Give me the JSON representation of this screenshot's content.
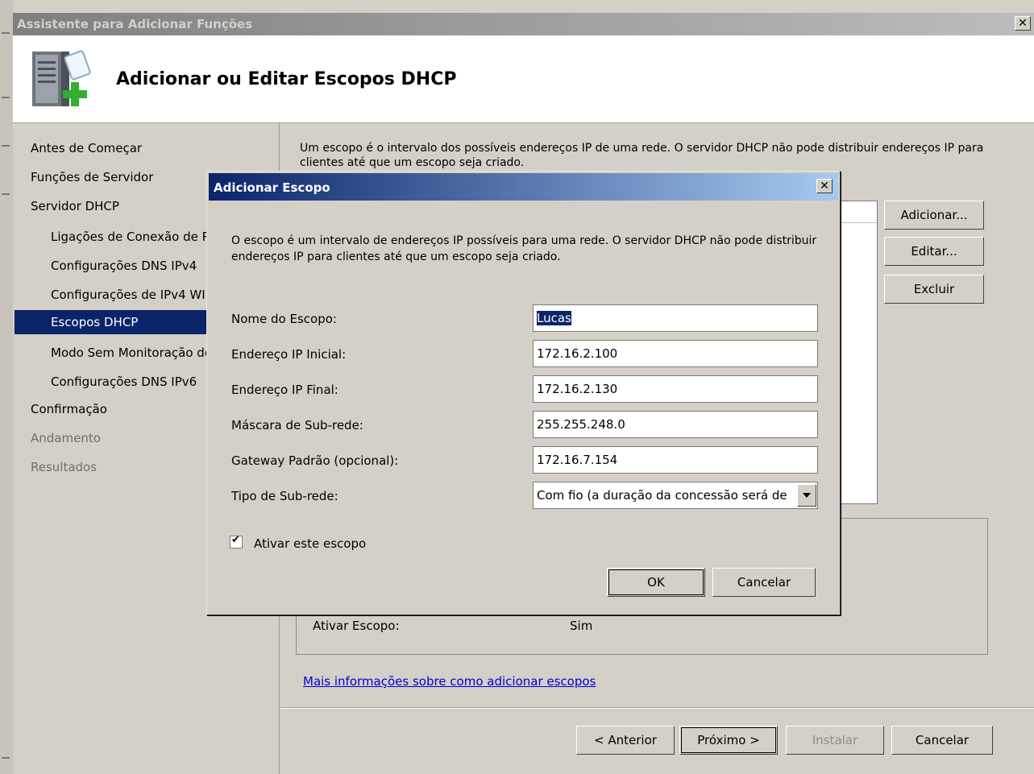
{
  "window": {
    "title": "Assistente para Adicionar Funções",
    "close_glyph": "✕"
  },
  "header": {
    "title": "Adicionar ou Editar Escopos DHCP",
    "icon": "server-add-icon"
  },
  "nav": {
    "items": [
      {
        "label": "Antes de Começar"
      },
      {
        "label": "Funções de Servidor"
      },
      {
        "label": "Servidor DHCP"
      },
      {
        "label": "Ligações de Conexão de Rede"
      },
      {
        "label": "Configurações DNS IPv4"
      },
      {
        "label": "Configurações de IPv4 WINS"
      },
      {
        "label": "Escopos DHCP"
      },
      {
        "label": "Modo Sem Monitoração de Estado DHCPv6"
      },
      {
        "label": "Configurações DNS IPv6"
      },
      {
        "label": "Confirmação"
      },
      {
        "label": "Andamento"
      },
      {
        "label": "Resultados"
      }
    ]
  },
  "content": {
    "description": "Um escopo é o intervalo dos possíveis endereços IP de uma rede. O servidor DHCP não pode distribuir endereços IP para clientes até que um escopo seja criado.",
    "buttons": {
      "add": "Adicionar...",
      "edit": "Editar...",
      "delete": "Excluir"
    },
    "detail": {
      "activate_label": "Ativar Escopo:",
      "activate_value": "Sim"
    },
    "link": "Mais informações sobre como adicionar escopos"
  },
  "footer": {
    "prev": "< Anterior",
    "next": "Próximo >",
    "install": "Instalar",
    "cancel": "Cancelar"
  },
  "dialog": {
    "title": "Adicionar Escopo",
    "text": "O escopo é um intervalo de endereços IP possíveis para uma rede. O servidor DHCP não pode distribuir endereços IP para clientes até que um escopo seja criado.",
    "fields": {
      "scope_name": {
        "label": "Nome do Escopo:",
        "value": "Lucas"
      },
      "start_ip": {
        "label": "Endereço IP Inicial:",
        "value": "172.16.2.100"
      },
      "end_ip": {
        "label": "Endereço IP Final:",
        "value": "172.16.2.130"
      },
      "subnet_mask": {
        "label": "Máscara de Sub-rede:",
        "value": "255.255.248.0"
      },
      "gateway": {
        "label": "Gateway Padrão (opcional):",
        "value": "172.16.7.154"
      },
      "subnet_type": {
        "label": "Tipo de Sub-rede:",
        "value": "Com fio (a duração da concessão será de"
      }
    },
    "activate_checkbox": {
      "label": "Ativar este escopo",
      "checked": true,
      "glyph": "✔"
    },
    "ok": "OK",
    "cancel": "Cancelar"
  }
}
